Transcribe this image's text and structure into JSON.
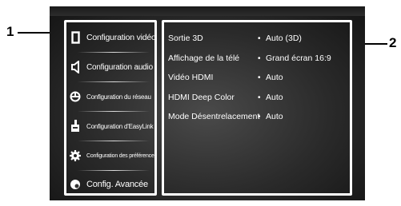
{
  "callouts": {
    "left": "1",
    "right": "2"
  },
  "menu": {
    "items": [
      {
        "label": "Configuration vidéo",
        "icon": "display-icon"
      },
      {
        "label": "Configuration audio",
        "icon": "speaker-icon"
      },
      {
        "label": "Configuration du réseau",
        "icon": "network-icon"
      },
      {
        "label": "Configuration d'EasyLink",
        "icon": "easylink-icon"
      },
      {
        "label": "Configuration des préférences",
        "icon": "preferences-icon"
      },
      {
        "label": "Config. Avancée",
        "icon": "advanced-icon"
      }
    ],
    "selected_index": 0
  },
  "settings": [
    {
      "name": "Sortie 3D",
      "value": "Auto (3D)"
    },
    {
      "name": "Affichage de la télé",
      "value": "Grand écran 16:9"
    },
    {
      "name": "Vidéo HDMI",
      "value": "Auto"
    },
    {
      "name": "HDMI Deep Color",
      "value": "Auto"
    },
    {
      "name": "Mode Désentrelacement",
      "value": "Auto"
    }
  ],
  "value_bullet": "•"
}
